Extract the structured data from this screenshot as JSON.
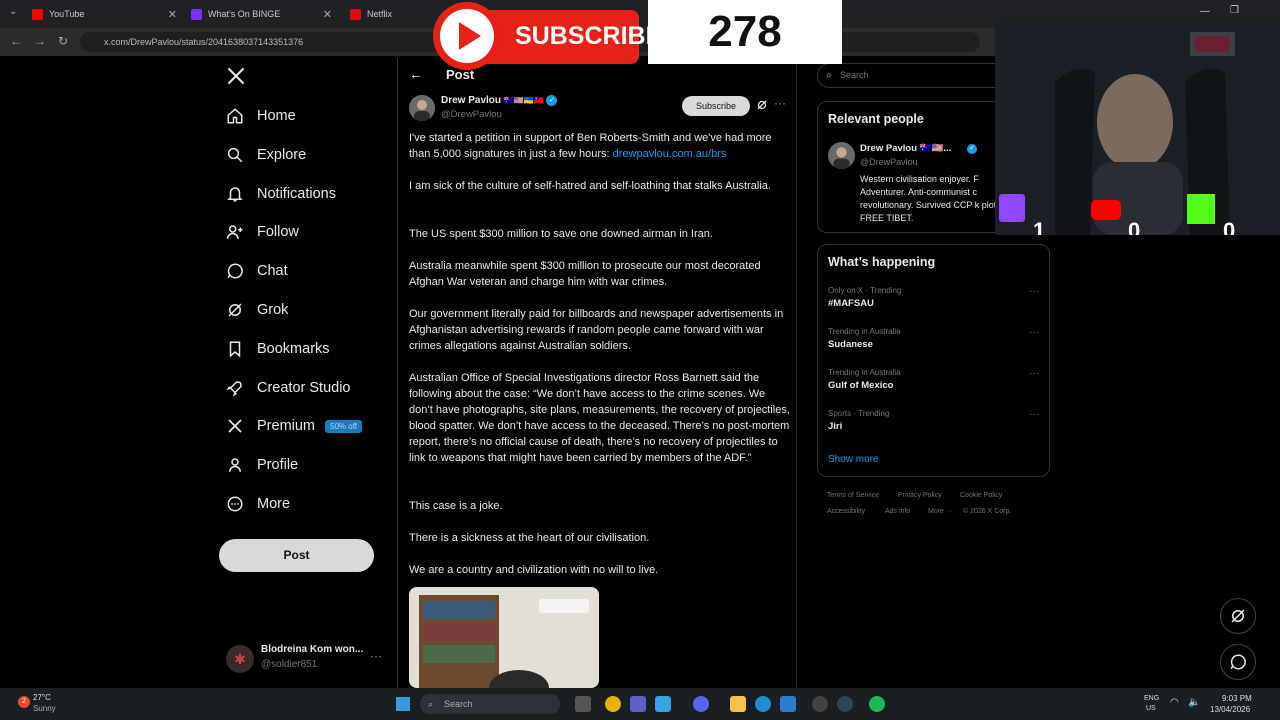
{
  "browser": {
    "tabs": [
      {
        "title": "YouTube",
        "color": "#ff0000"
      },
      {
        "title": "What's On BINGE",
        "color": "#7b2ff7"
      },
      {
        "title": "Netflix",
        "color": "#e50914"
      }
    ],
    "url": "x.com/DrewPavlou/status/2041638037143351376"
  },
  "nav": {
    "items": [
      {
        "label": "Home",
        "icon": "home-icon"
      },
      {
        "label": "Explore",
        "icon": "search-icon"
      },
      {
        "label": "Notifications",
        "icon": "bell-icon"
      },
      {
        "label": "Follow",
        "icon": "follow-icon"
      },
      {
        "label": "Chat",
        "icon": "chat-icon"
      },
      {
        "label": "Grok",
        "icon": "grok-icon"
      },
      {
        "label": "Bookmarks",
        "icon": "bookmark-icon"
      },
      {
        "label": "Creator Studio",
        "icon": "rocket-icon"
      },
      {
        "label": "Premium",
        "icon": "x-logo-icon",
        "badge": "50% off"
      },
      {
        "label": "Profile",
        "icon": "person-icon"
      },
      {
        "label": "More",
        "icon": "more-circle-icon"
      }
    ],
    "post_button": "Post",
    "account": {
      "name": "Blodreina Kom won...",
      "handle": "@soldier851"
    }
  },
  "post": {
    "header_title": "Post",
    "author_name": "Drew Pavlou",
    "author_flags": "🇦🇺🇺🇸🇺🇦🇹🇼",
    "author_handle": "@DrewPavlou",
    "subscribe_label": "Subscribe",
    "paragraphs": {
      "p1": "I've started a petition in support of Ben Roberts-Smith and we've had more than 5,000 signatures in just a few hours: ",
      "p1_link": "drewpavlou.com.au/brs",
      "p2": "I am sick of the culture of self-hatred and self-loathing that stalks Australia.",
      "p3": "The US spent $300 million to save one downed airman in Iran.",
      "p4": "Australia meanwhile spent $300 million to prosecute our most decorated Afghan War veteran and charge him with war crimes.",
      "p5": "Our government literally paid for billboards and newspaper advertisements in Afghanistan advertising rewards if random people came forward with war crimes allegations against Australian soldiers.",
      "p6": "Australian Office of Special Investigations director Ross Barnett said the following about the case: “We don’t have access to the crime scenes. We don’t have photographs, site plans, measurements, the recovery of projectiles, blood spatter. We don’t have access to the deceased. There’s no post-mortem report, there’s no official cause of death, there’s no recovery of projectiles to link to weapons that might have been carried by members of the ADF.”",
      "p7": "This case is a joke.",
      "p8": "There is a sickness at the heart of our civilisation.",
      "p9": "We are a country and civilization with no will to live."
    }
  },
  "right": {
    "search_placeholder": "Search",
    "relevant_title": "Relevant people",
    "relevant_person": {
      "name": "Drew Pavlou 🇦🇺🇺🇸...",
      "handle": "@DrewPavlou",
      "bio": "Western civilisation enjoyer. F Adventurer. Anti-communist c revolutionary. Survived CCP k plot. FREE TIBET."
    },
    "happening_title": "What’s happening",
    "trends": [
      {
        "context": "Only on X · Trending",
        "title": "#MAFSAU"
      },
      {
        "context": "Trending in Australia",
        "title": "Sudanese"
      },
      {
        "context": "Trending in Australia",
        "title": "Gulf of Mexico"
      },
      {
        "context": "Sports · Trending",
        "title": "Jiri"
      }
    ],
    "show_more": "Show more",
    "footer": {
      "tos": "Terms of Service",
      "privacy": "Privacy Policy",
      "cookie": "Cookie Policy",
      "accessibility": "Accessibility",
      "ads": "Ads info",
      "more": "More ···",
      "copyright": "© 2026 X Corp."
    }
  },
  "overlay": {
    "subscribe_text": "SUBSCRIBE",
    "counter": "278",
    "twitch_count": "1",
    "youtube_count": "0",
    "kick_count": "0"
  },
  "taskbar": {
    "weather_temp": "27°C",
    "weather_cond": "Sunny",
    "search": "Search",
    "lang1": "ENG",
    "lang2": "US",
    "time": "9:03 PM",
    "date": "13/04/2026",
    "badge_count": "2"
  }
}
